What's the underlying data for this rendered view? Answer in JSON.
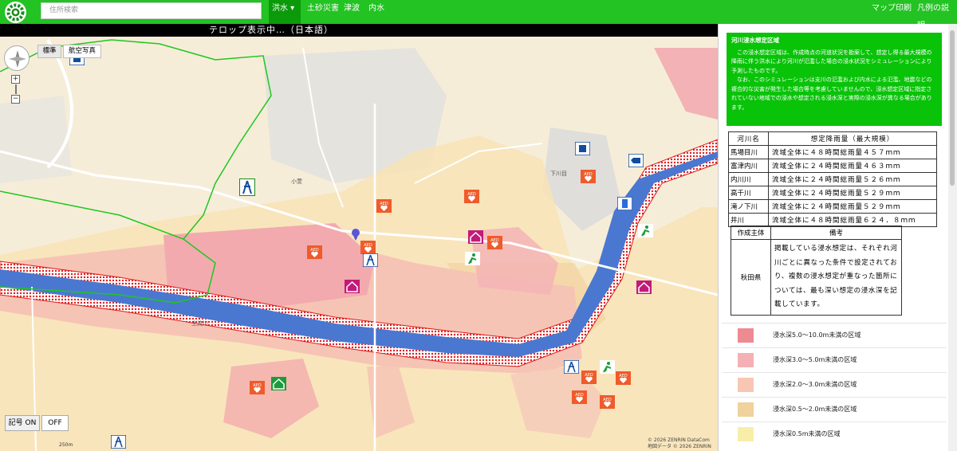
{
  "header": {
    "search_placeholder": "住所検索",
    "nav": {
      "flood": "洪水 ▾",
      "sediment": "土砂災害",
      "tsunami": "津波",
      "inland": "内水",
      "print": "マップ印刷",
      "legend": "凡例の説明"
    }
  },
  "map": {
    "ticker": "テロップ表示中…（日本語）",
    "maptype": {
      "standard": "標準",
      "aerial": "航空写真"
    },
    "zoom": {
      "in": "+",
      "out": "−"
    },
    "marks": {
      "on": "記号 ON",
      "off": "OFF"
    },
    "scale": "250m",
    "copyright_1": "© 2026 ZENRIN DataCom",
    "copyright_2": "地図データ © 2026 ZENRIN",
    "colors": {
      "flood_deep": "#f0a2a8",
      "flood_mid": "#f6c1b6",
      "flood_shallow": "#f8e0c4",
      "river": "#4a78d0",
      "boundary": "#1ec81e"
    },
    "place_labels": {
      "river_name": "上流川",
      "area_1": "小萱",
      "area_2": "下川目"
    }
  },
  "panel": {
    "notice": {
      "title": "河川浸水想定区域",
      "para1": "この浸水想定区域は、作成時点の河道状況を勘案して、想定し得る最大規模の降雨に伴う洪水により河川が氾濫した場合の浸水状況をシミュレーションにより予測したものです。",
      "para2": "なお、このシミュレーションは支川の氾濫および内水による氾濫、地震などの複合的な災害が発生した場合等を考慮していませんので、浸水想定区域に指定されていない地域での浸水や想定される浸水深と実際の浸水深が異なる場合があります。"
    },
    "rain_table": {
      "header_river": "河川名",
      "header_rain": "想定降雨量（最大規模）",
      "rows": [
        {
          "river": "馬場目川",
          "rain": "流域全体に４８時間総雨量４５７ｍｍ"
        },
        {
          "river": "富津内川",
          "rain": "流域全体に２４時間総雨量４６３ｍｍ"
        },
        {
          "river": "内川川",
          "rain": "流域全体に２４時間総雨量５２６ｍｍ"
        },
        {
          "river": "高千川",
          "rain": "流域全体に２４時間総雨量５２９ｍｍ"
        },
        {
          "river": "滝ノ下川",
          "rain": "流域全体に２４時間総雨量５２９ｍｍ"
        },
        {
          "river": "井川",
          "rain": "流域全体に４８時間総雨量６２４．８ｍｍ"
        }
      ]
    },
    "note_table": {
      "header_author": "作成主体",
      "header_memo": "備考",
      "author": "秋田県",
      "memo": "掲載している浸水想定は、それぞれ河川ごとに異なった条件で設定されており、複数の浸水想定が重なった箇所については、最も深い想定の浸水深を記載しています。"
    },
    "legend": [
      {
        "label": "浸水深5.0～10.0m未満の区域",
        "color": "#ee8a92"
      },
      {
        "label": "浸水深3.0～5.0m未満の区域",
        "color": "#f4b0b4"
      },
      {
        "label": "浸水深2.0～3.0m未満の区域",
        "color": "#f8c7b4"
      },
      {
        "label": "浸水深0.5～2.0m未満の区域",
        "color": "#f1d19c"
      },
      {
        "label": "浸水深0.5m未満の区域",
        "color": "#f8eea8"
      }
    ]
  }
}
